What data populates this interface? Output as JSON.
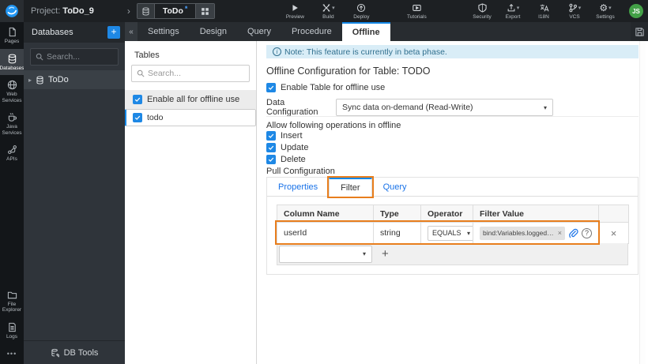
{
  "colors": {
    "accent_blue": "#1e88e5",
    "active_tab_blue": "#1588e6",
    "link_blue": "#1a73e8",
    "annotation_orange": "#e87e1d",
    "note_bg": "#d9edf7",
    "note_text": "#31708f",
    "avatar_green": "#43a047",
    "topbar_bg": "#1d2023"
  },
  "topbar": {
    "project_prefix": "Project:",
    "project_name": "ToDo_9",
    "breadcrumb_chevron": "›",
    "artifact_tab": {
      "name": "ToDo",
      "modified_indicator": "*"
    },
    "actions_left": [
      {
        "label": "Preview"
      },
      {
        "label": "Build",
        "caret": "▾"
      },
      {
        "label": "Deploy"
      },
      {
        "label": "Tutorials"
      }
    ],
    "actions_right": [
      {
        "label": "Security"
      },
      {
        "label": "Export",
        "caret": "▾"
      },
      {
        "label": "I18N"
      },
      {
        "label": "VCS",
        "caret": "▾"
      },
      {
        "label": "Settings",
        "caret": "▾"
      }
    ],
    "avatar_initials": "JS"
  },
  "sidebar": {
    "items": [
      {
        "label": "Pages"
      },
      {
        "label": "Databases"
      },
      {
        "label": "Web Services"
      },
      {
        "label": "Java Services"
      },
      {
        "label": "APIs"
      },
      {
        "label": "File Explorer"
      },
      {
        "label": "Logs"
      }
    ],
    "more": "•••"
  },
  "db_panel": {
    "title": "Databases",
    "add_label": "+",
    "search_placeholder": "Search...",
    "item_caret": "▸",
    "items": [
      {
        "label": "ToDo"
      }
    ],
    "footer_label": "DB Tools"
  },
  "workspace": {
    "collapse_icon": "«",
    "tabs": [
      {
        "label": "Settings"
      },
      {
        "label": "Design"
      },
      {
        "label": "Query"
      },
      {
        "label": "Procedure"
      },
      {
        "label": "Offline",
        "active": true
      }
    ]
  },
  "tables_panel": {
    "title": "Tables",
    "search_placeholder": "Search...",
    "enable_all": {
      "label": "Enable all for offline use",
      "checked": true
    },
    "tables": [
      {
        "label": "todo",
        "checked": true,
        "selected": true
      }
    ]
  },
  "main": {
    "note_text": "Note: This feature is currently in beta phase.",
    "note_icon": "i",
    "heading": "Offline Configuration for Table: TODO",
    "enable_table_label": "Enable Table for offline use",
    "data_configuration": {
      "label": "Data Configuration",
      "value": "Sync data on-demand (Read-Write)",
      "caret": "▾"
    },
    "operations": {
      "label": "Allow following operations in offline",
      "items": [
        {
          "label": "Insert",
          "checked": true
        },
        {
          "label": "Update",
          "checked": true
        },
        {
          "label": "Delete",
          "checked": true
        }
      ]
    },
    "pull_configuration": {
      "label": "Pull Configuration",
      "tabs": [
        {
          "label": "Properties"
        },
        {
          "label": "Filter",
          "active": true
        },
        {
          "label": "Query"
        }
      ],
      "filter_table": {
        "headers": [
          "Column Name",
          "Type",
          "Operator",
          "Filter Value"
        ],
        "rows": [
          {
            "column_name": "userId",
            "type": "string",
            "operator": "EQUALS",
            "operator_caret": "▾",
            "filter_value": "bind:Variables.loggedInUser.data",
            "remove_symbol": "×",
            "delete_symbol": "×"
          }
        ],
        "new_row_caret": "▾",
        "add_symbol": "+"
      }
    }
  }
}
